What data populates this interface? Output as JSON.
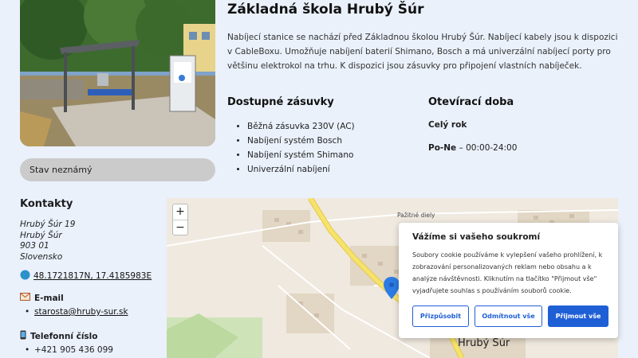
{
  "station": {
    "title": "Základná škola Hrubý Šúr",
    "description": "Nabíjecí stanice se nachází před Základnou školou Hrubý Šúr. Nabíjecí kabely jsou k dispozici v CableBoxu. Umožňuje nabíjení baterií Shimano, Bosch a má univerzální nabíjecí porty pro většinu elektrokol na trhu. K dispozici jsou zásuvky pro připojení vlastních nabíječek.",
    "status": "Stav neznámý"
  },
  "sockets": {
    "title": "Dostupné zásuvky",
    "items": [
      "Běžná zásuvka 230V (AC)",
      "Nabíjení systém Bosch",
      "Nabíjení systém Shimano",
      "Univerzální nabíjení"
    ]
  },
  "hours": {
    "title": "Otevírací doba",
    "subtitle": "Celý rok",
    "day": "Po-Ne",
    "time": " – 00:00-24:00"
  },
  "contacts": {
    "title": "Kontakty",
    "address": [
      "Hrubý Šúr 19",
      "Hrubý Šúr",
      "903 01",
      "Slovensko"
    ],
    "gps": "48.1721817N, 17.4185983E",
    "email_label": "E-mail",
    "email": "starosta@hruby-sur.sk",
    "phone_label": "Telefonní číslo",
    "phone": "+421 905 436 099"
  },
  "map": {
    "zoom_in": "+",
    "zoom_out": "−",
    "village_label": "Hrubý Šúr",
    "field_label": "Pažitné diely"
  },
  "cookie": {
    "title": "Vážíme si vašeho soukromí",
    "text": "Soubory cookie používáme k vylepšení vašeho prohlížení, k zobrazování personalizovaných reklam nebo obsahu a k analýze návštěvnosti. Kliknutím na tlačítko \"Přijmout vše\" vyjadřujete souhlas s používáním souborů cookie.",
    "customize": "Přizpůsobit",
    "reject": "Odmítnout vše",
    "accept": "Přijmout vše"
  },
  "colors": {
    "accent": "#1f5fd6",
    "pill": "#cbcbcb",
    "background": "#eaf1fb",
    "road": "#f6e36b"
  }
}
